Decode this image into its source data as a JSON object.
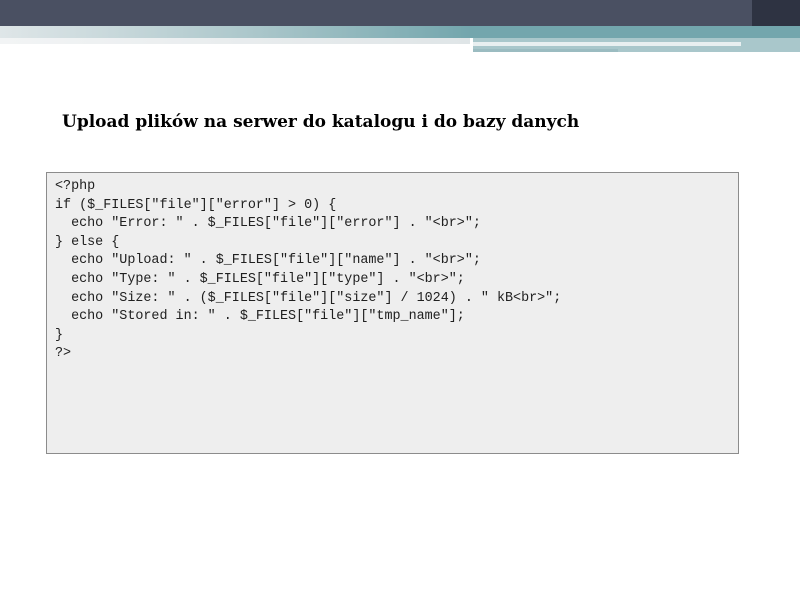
{
  "slide": {
    "title": "Upload plików na serwer do katalogu i do bazy danych",
    "code_lines": [
      "<?php",
      "if ($_FILES[\"file\"][\"error\"] > 0) {",
      "  echo \"Error: \" . $_FILES[\"file\"][\"error\"] . \"<br>\";",
      "} else {",
      "  echo \"Upload: \" . $_FILES[\"file\"][\"name\"] . \"<br>\";",
      "  echo \"Type: \" . $_FILES[\"file\"][\"type\"] . \"<br>\";",
      "  echo \"Size: \" . ($_FILES[\"file\"][\"size\"] / 1024) . \" kB<br>\";",
      "  echo \"Stored in: \" . $_FILES[\"file\"][\"tmp_name\"];",
      "}",
      "?>"
    ]
  },
  "colors": {
    "header_dark": "#4a5062",
    "header_teal": "#73a6ad",
    "code_background": "#eeeeee",
    "code_border": "#8c8c8c"
  }
}
